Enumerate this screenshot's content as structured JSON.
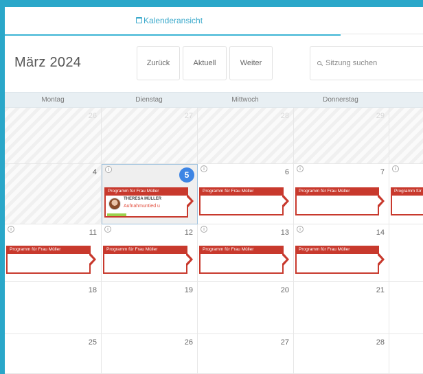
{
  "tabs": {
    "calendar_label": "Kalenderansicht"
  },
  "toolbar": {
    "month_title": "März 2024",
    "back_label": "Zurück",
    "today_label": "Aktuell",
    "next_label": "Weiter",
    "search_placeholder": "Sitzung suchen"
  },
  "calendar": {
    "weekdays": [
      "Montag",
      "Dienstag",
      "Mittwoch",
      "Donnerstag"
    ],
    "weeks": [
      [
        "26",
        "27",
        "28",
        "29"
      ],
      [
        "4",
        "5",
        "6",
        "7"
      ],
      [
        "11",
        "12",
        "13",
        "14"
      ],
      [
        "18",
        "19",
        "20",
        "21"
      ],
      [
        "25",
        "26",
        "27",
        "28"
      ]
    ],
    "today": "5",
    "info_icon_label": "i",
    "event_title": "Programm für Frau Müller",
    "attendee": {
      "name": "THERESA MÜLLER",
      "status": "Aufnahmuntied u"
    }
  },
  "colors": {
    "accent": "#3aa9cb",
    "event_red": "#c8392d",
    "today_badge": "#3d85e4",
    "frame": "#2aa7c9"
  }
}
